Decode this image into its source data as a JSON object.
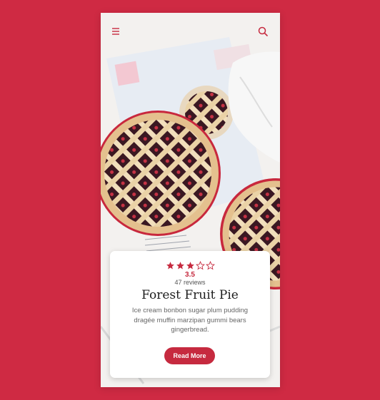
{
  "header": {
    "menu_icon": "hamburger-menu-icon",
    "search_icon": "search-icon"
  },
  "recipe": {
    "rating_value": 3.5,
    "rating_text": "3.5",
    "reviews_text": "47 reviews",
    "title": "Forest Fruit Pie",
    "description": "Ice cream bonbon sugar plum pudding dragée muffin marzipan gummi bears gingerbread.",
    "button_label": "Read More"
  },
  "colors": {
    "background": "#cf2a43",
    "accent": "#c62a3f",
    "card": "#ffffff"
  }
}
